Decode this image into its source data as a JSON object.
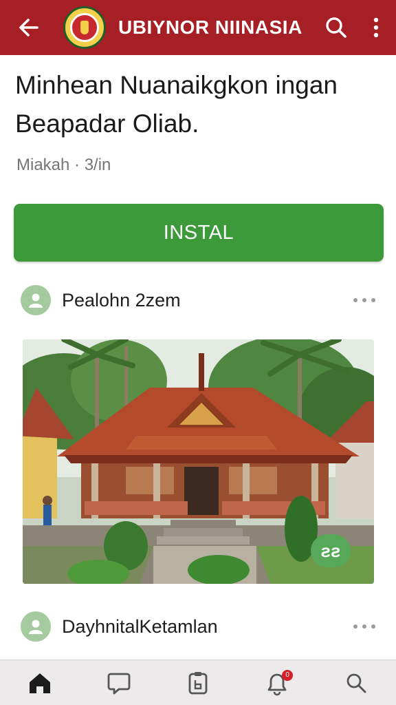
{
  "app_bar": {
    "title": "UBIYNOR NIINASIA",
    "back_icon": "arrow-left-icon",
    "logo": "emblem-logo",
    "actions": [
      "search-icon",
      "more-vertical-icon"
    ]
  },
  "article": {
    "headline": "Minhean Nuanaikgkon ingan Beapadar Oliab.",
    "meta": "Miakah · 3/in"
  },
  "install_button": {
    "label": "INSTAL",
    "color": "#3c9a3a"
  },
  "posts": [
    {
      "author": "Pealohn 2zem",
      "avatar_icon": "user-icon",
      "menu_icon": "more-horizontal-icon",
      "badge": "ƨƨ"
    },
    {
      "author": "DayhnitalKetamlan",
      "avatar_icon": "user-icon",
      "menu_icon": "more-horizontal-icon"
    }
  ],
  "bottom_nav": {
    "items": [
      "home-icon",
      "chat-icon",
      "clipboard-icon",
      "bell-icon",
      "search-icon"
    ],
    "active": "home-icon",
    "notification_count": "0"
  },
  "colors": {
    "app_bar": "#a51f24",
    "accent_green": "#3c9a3a",
    "nav_bg": "#eceaea"
  }
}
